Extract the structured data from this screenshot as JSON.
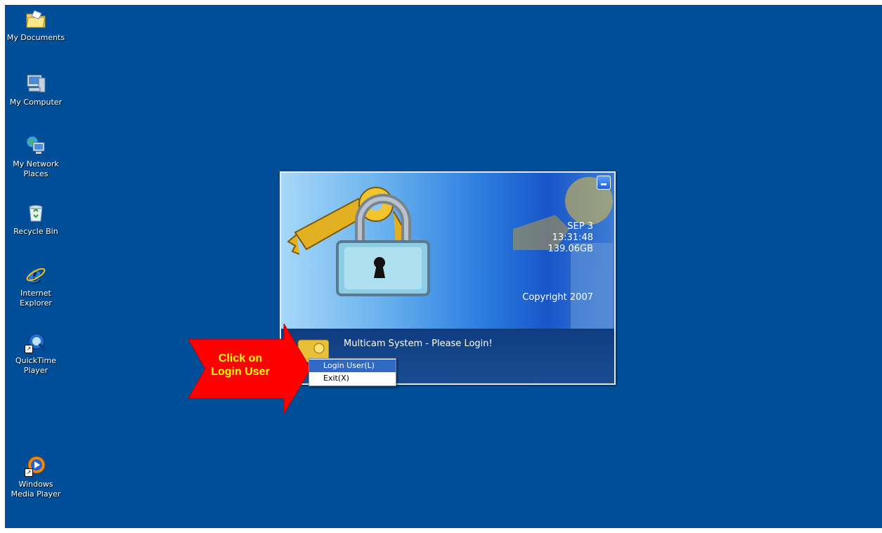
{
  "desktop": {
    "background": "#004e98",
    "icons": [
      {
        "label": "My Documents",
        "icon": "folder-icon"
      },
      {
        "label": "My Computer",
        "icon": "computer-icon"
      },
      {
        "label": "My Network Places",
        "icon": "network-icon"
      },
      {
        "label": "Recycle Bin",
        "icon": "recycle-bin-icon"
      },
      {
        "label": "Internet Explorer",
        "icon": "internet-explorer-icon"
      },
      {
        "label": "QuickTime Player",
        "icon": "quicktime-icon"
      },
      {
        "label": "Windows Media Player",
        "icon": "media-player-icon"
      }
    ]
  },
  "login_window": {
    "date": "SEP  3",
    "time": "13:31:48",
    "disk": "139.06GB",
    "copyright": "Copyright 2007",
    "status": "Multicam System - Please Login!"
  },
  "context_menu": {
    "items": [
      {
        "label": "Login User(L)",
        "selected": true
      },
      {
        "label": "Exit(X)",
        "selected": false
      }
    ]
  },
  "callout": {
    "line1": "Click on",
    "line2": "Login User",
    "color": "#ff0000",
    "text_color": "#ffff00"
  }
}
